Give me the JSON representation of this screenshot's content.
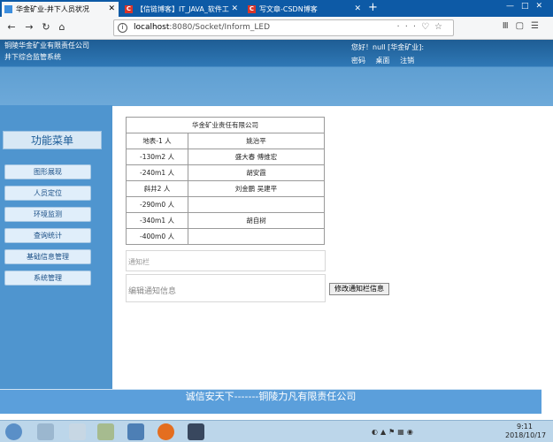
{
  "browser": {
    "tabs": [
      {
        "label": "华金矿业-井下人员状况",
        "active": true
      },
      {
        "label": "【信链博客】IT_JAVA_软件工",
        "active": false
      },
      {
        "label": "写文章-CSDN博客",
        "active": false
      }
    ],
    "url_host": "localhost",
    "url_rest": ":8080/Socket/Inform_LED",
    "new_tab": "+"
  },
  "header": {
    "company": "铜陵华金矿业有限责任公司",
    "system": "井下综合监管系统",
    "greeting": "您好！null   [华金矿业]:",
    "links": [
      "密码",
      "桌面",
      "注销"
    ]
  },
  "sidebar": {
    "title": "功能菜单",
    "items": [
      "图形展现",
      "人员定位",
      "环境监测",
      "查询统计",
      "基础信息管理",
      "系统管理"
    ]
  },
  "table": {
    "title": "华金矿业责任有限公司",
    "rows": [
      {
        "location": "地表-1 人",
        "names": "姚治平"
      },
      {
        "location": "-130m2 人",
        "names": "盛大春 傅维宏"
      },
      {
        "location": "-240m1 人",
        "names": "胡安霞"
      },
      {
        "location": "斜井2 人",
        "names": "刘金鹏 吴建平"
      },
      {
        "location": "-290m0 人",
        "names": ""
      },
      {
        "location": "-340m1 人",
        "names": "胡自树"
      },
      {
        "location": "-400m0 人",
        "names": ""
      }
    ]
  },
  "notice": {
    "label": "通知栏",
    "edit_placeholder": "编辑通知信息",
    "button": "修改通知栏信息"
  },
  "footer": {
    "text": "诚信安天下-------铜陵力凡有限责任公司"
  },
  "taskbar": {
    "time": "9:11",
    "date": "2018/10/17"
  }
}
